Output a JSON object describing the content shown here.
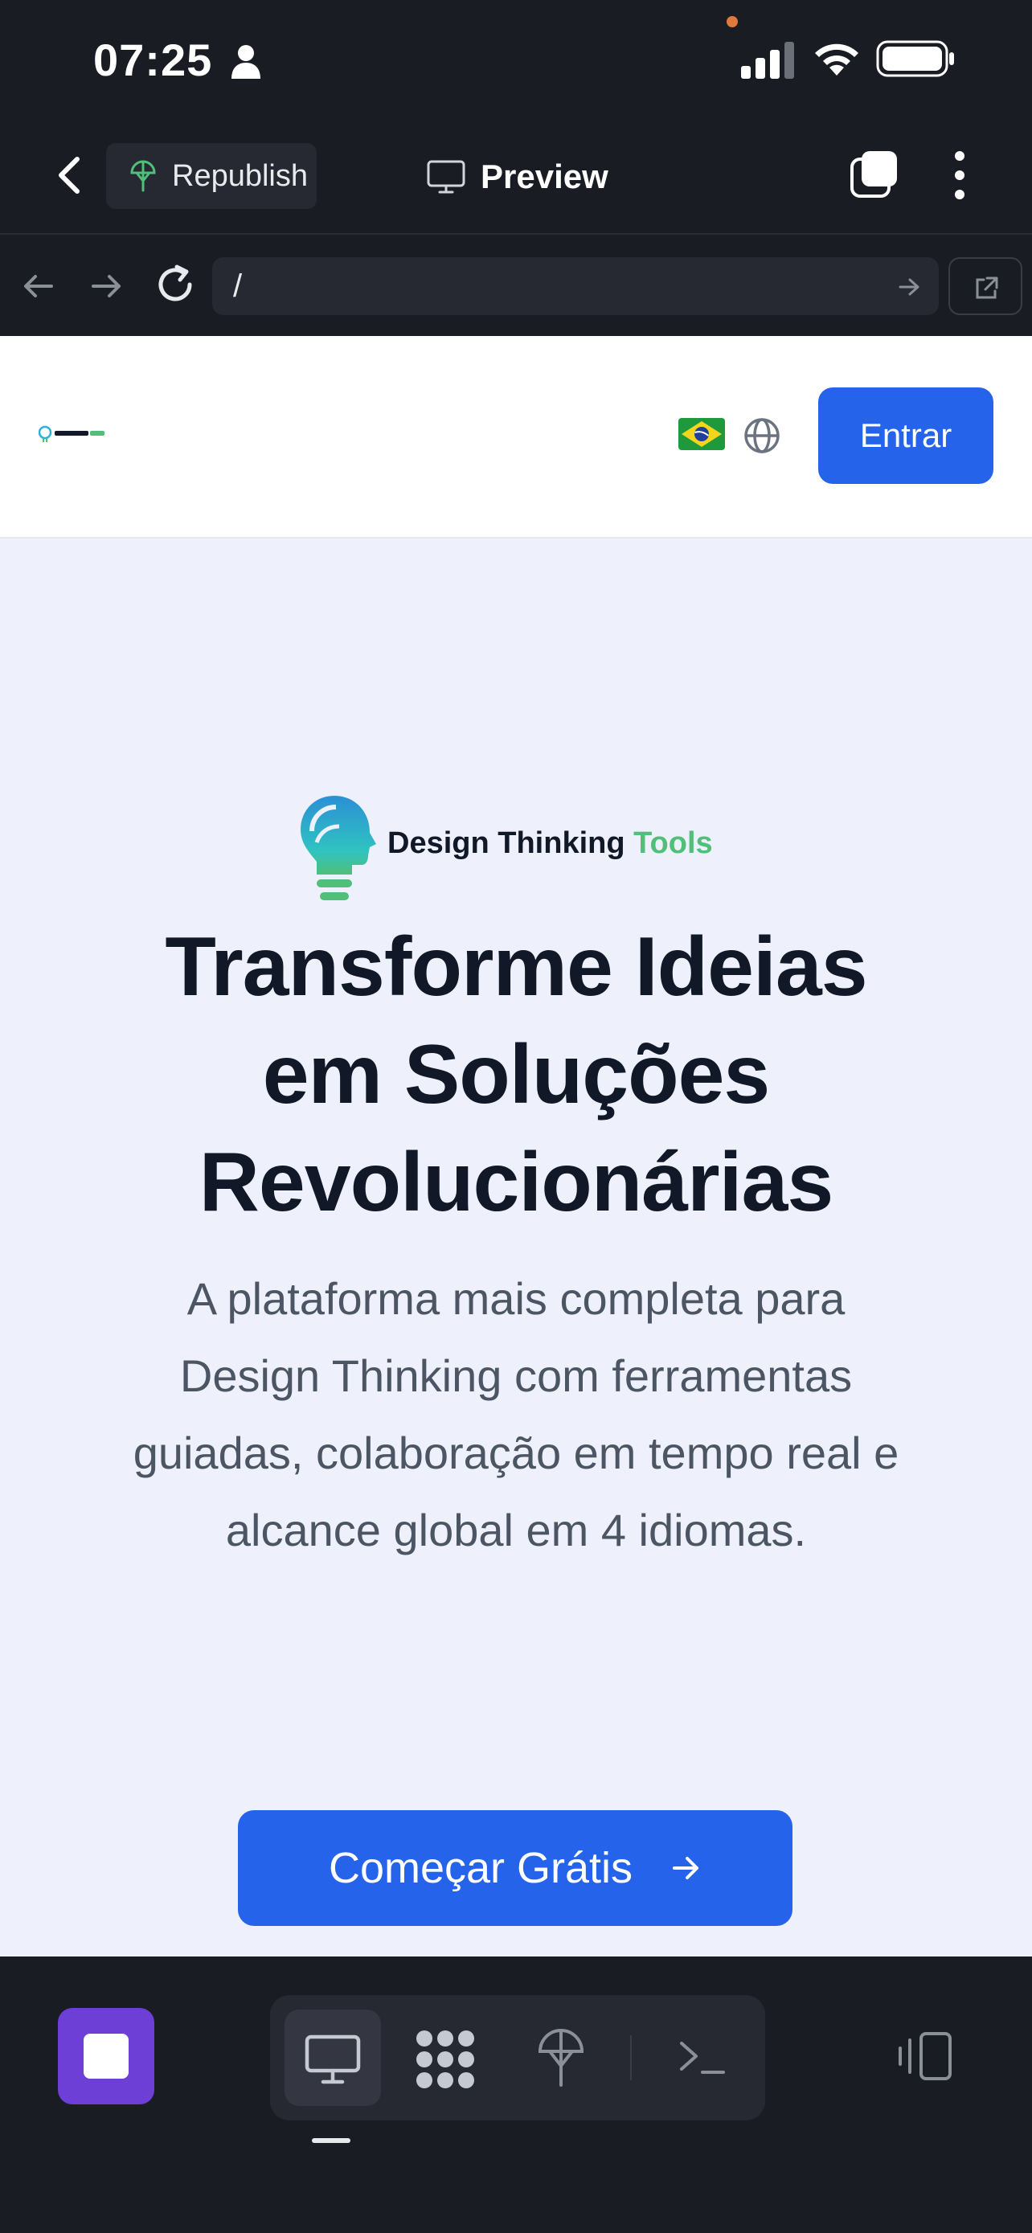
{
  "status_bar": {
    "time": "07:25",
    "icons": [
      "person-icon",
      "signal-icon",
      "wifi-icon",
      "battery-icon"
    ]
  },
  "toolbar": {
    "republish_label": "Republish",
    "preview_label": "Preview",
    "icons": [
      "back-icon",
      "deploy-icon",
      "monitor-icon",
      "tabs-icon",
      "more-vertical-icon"
    ]
  },
  "url_bar": {
    "url": "/",
    "icons": [
      "arrow-left-icon",
      "arrow-right-icon",
      "reload-icon",
      "arrow-right-small-icon",
      "external-link-icon"
    ]
  },
  "site": {
    "header": {
      "language_flag": "brazil-flag-icon",
      "login_label": "Entrar"
    },
    "hero": {
      "brand_main": "Design Thinking",
      "brand_accent": "Tools",
      "title_lines": [
        "Transforme Ideias",
        "em Soluções",
        "Revolucionárias"
      ],
      "subtitle_lines": [
        "A plataforma mais completa para",
        "Design Thinking com ferramentas",
        "guiadas, colaboração em tempo real e",
        "alcance global em 4 idiomas."
      ],
      "cta_label": "Começar Grátis"
    }
  },
  "bottom_bar": {
    "tools": [
      "desktop-icon",
      "grid-icon",
      "deploy-icon",
      "terminal-icon"
    ],
    "active_tool": "desktop-icon"
  },
  "colors": {
    "app_background": "#1a1c23",
    "primary_blue": "#2563eb",
    "brand_green": "#4fbf7a",
    "stop_purple": "#6d3fd6",
    "hero_background": "#eef1fb"
  }
}
